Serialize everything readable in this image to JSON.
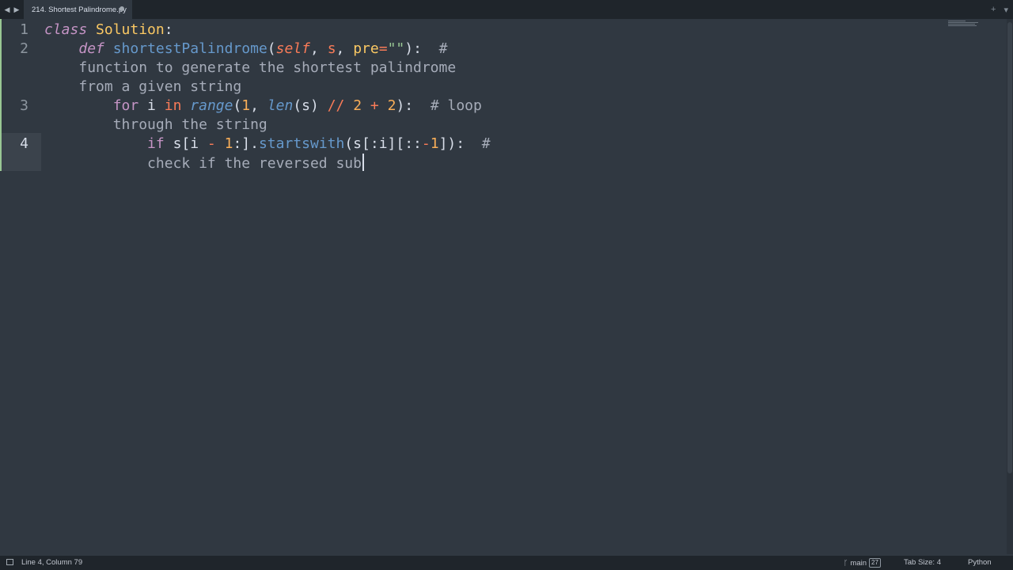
{
  "tabbar": {
    "tab_title": "214. Shortest Palindrome.py",
    "back_icon": "◀",
    "forward_icon": "▶",
    "new_tab_icon": "+",
    "tab_list_icon": "▾"
  },
  "editor": {
    "line_numbers": [
      "1",
      "2",
      "3",
      "4"
    ],
    "current_line": 4,
    "lines": {
      "l1": {
        "kw": "class",
        "name": "Solution",
        "colon": ":"
      },
      "l2": {
        "kw": "def",
        "fn": "shortestPalindrome",
        "lp": "(",
        "self": "self",
        "sep1": ", ",
        "s": "s",
        "sep2": ", ",
        "pre": "pre",
        "eq": "=",
        "str": "\"\"",
        "rp": "):",
        "cmt": "  #",
        "wrap1": "function to generate the shortest palindrome",
        "wrap2": "from a given string"
      },
      "l3": {
        "kw_for": "for",
        "i": " i ",
        "kw_in": "in",
        "sp": " ",
        "range": "range",
        "lp": "(",
        "one": "1",
        "comma": ", ",
        "len": "len",
        "args": "(s) ",
        "floordiv": "//",
        "sp2": " ",
        "two": "2",
        "sp3": " ",
        "plus": "+",
        "sp4": " ",
        "two2": "2",
        "rp": "):",
        "cmt": "  # loop",
        "wrap": "through the string"
      },
      "l4": {
        "kw_if": "if",
        "a": " s[i ",
        "minus": "-",
        "b": " ",
        "one": "1",
        "c": ":].",
        "fn": "startswith",
        "d": "(s[:i][::",
        "neg": "-",
        "one2": "1",
        "e": "]):",
        "cmt": "  #",
        "wrap": "check if the reversed sub"
      }
    }
  },
  "statusbar": {
    "position": "Line 4, Column 79",
    "branch": "main",
    "branch_badge": "27",
    "tab_size": "Tab Size: 4",
    "syntax": "Python"
  },
  "colors": {
    "background": "#303841",
    "keyword": "#c594c5",
    "class_name": "#fac863",
    "function": "#6699cc",
    "parameter": "#f97b58",
    "number": "#f9ae58",
    "string": "#99c794",
    "comment": "#a6acb9"
  }
}
